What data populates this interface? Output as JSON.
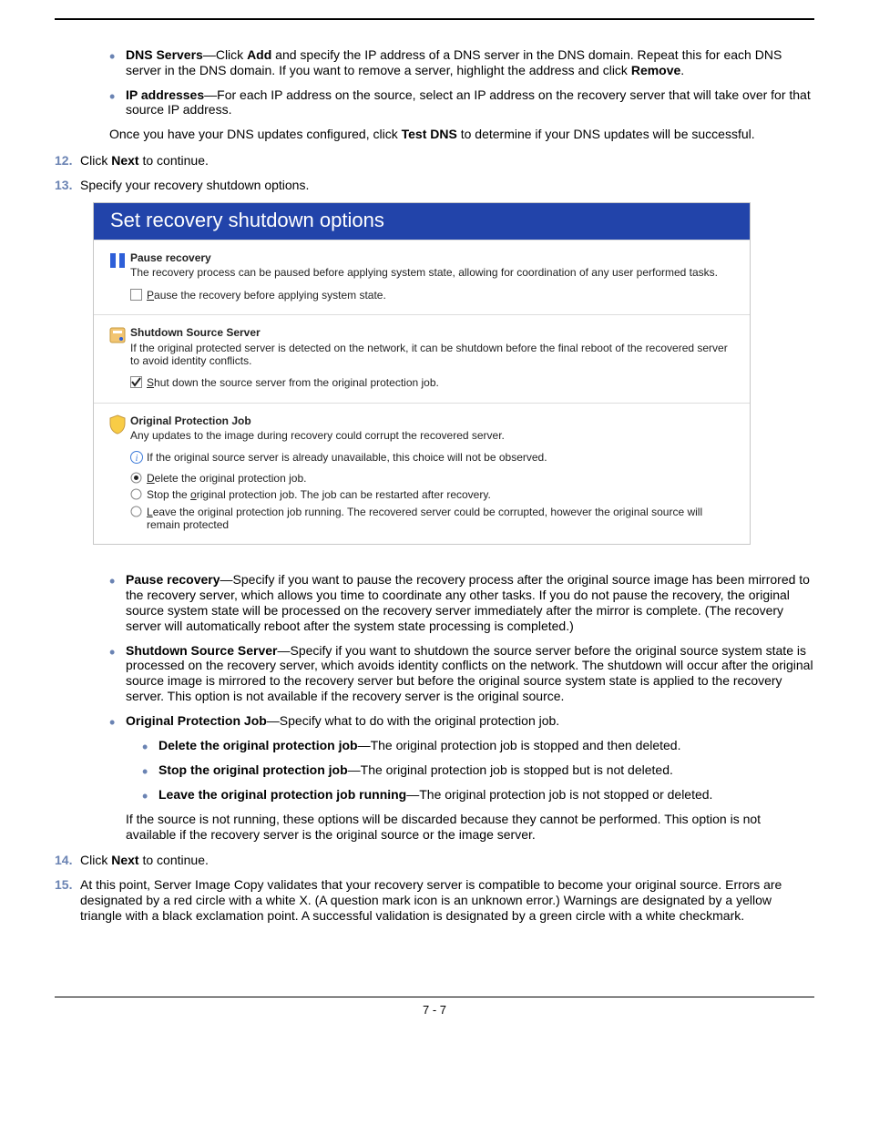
{
  "page_number": "7 - 7",
  "upper_bullets": {
    "dns": {
      "label": "DNS Servers",
      "pre": "—Click ",
      "add": "Add",
      "mid": " and specify the IP address of a DNS server in the DNS domain. Repeat this for each DNS server in the DNS domain. If you want to remove a server, highlight the address and click ",
      "remove": "Remove",
      "end": "."
    },
    "ip": {
      "label": "IP addresses",
      "text": "—For each IP address on the source, select an IP address on the recovery server that will take over for that source IP address."
    }
  },
  "dns_test_para": {
    "pre": "Once you have your DNS updates configured, click ",
    "bold": "Test DNS",
    "post": " to determine if your DNS updates will be successful."
  },
  "steps": {
    "s12": {
      "num": "12.",
      "pre": "Click ",
      "bold": "Next",
      "post": " to continue."
    },
    "s13": {
      "num": "13.",
      "text": "Specify your recovery shutdown options."
    },
    "s14": {
      "num": "14.",
      "pre": "Click ",
      "bold": "Next",
      "post": " to continue."
    },
    "s15": {
      "num": "15.",
      "text": "At this point, Server Image Copy validates that your recovery server is compatible to become your original source. Errors are designated by a red circle with a white X. (A question mark icon is an unknown error.) Warnings are designated by a yellow triangle with a black exclamation point. A successful validation is designated by a green circle with a white checkmark."
    }
  },
  "dialog": {
    "title": "Set recovery shutdown options",
    "pause": {
      "heading": "Pause recovery",
      "sub": "The recovery process can be paused before applying system state, allowing for coordination of any user performed tasks.",
      "checkbox_letter": "P",
      "checkbox_rest": "ause the recovery before applying system state."
    },
    "shutdown": {
      "heading": "Shutdown Source Server",
      "sub": "If the original protected server is detected on the network, it can be shutdown before the final reboot of the recovered server to avoid identity conflicts.",
      "checkbox_letter": "S",
      "checkbox_rest": "hut down the source server from the original protection job."
    },
    "original": {
      "heading": "Original Protection Job",
      "sub": "Any updates to the image during recovery could corrupt the recovered server.",
      "note": "If the original source server is already unavailable, this choice will not be observed.",
      "r1_letter": "D",
      "r1_rest": "elete the original protection job.",
      "r2_pre": "Stop the ",
      "r2_letter": "o",
      "r2_rest": "riginal protection job. The job can be restarted after recovery.",
      "r3_letter": "L",
      "r3_rest": "eave the original protection job running. The recovered server could be corrupted, however the original source will remain protected"
    }
  },
  "explain": {
    "pause": {
      "label": "Pause recovery",
      "text": "—Specify if you want to pause the recovery process after the original source image has been mirrored to the recovery server, which allows you time to coordinate any other tasks. If you do not pause the recovery, the original source system state will be processed on the recovery server immediately after the mirror is complete. (The recovery server will automatically reboot after the system state processing is completed.)"
    },
    "shutdown": {
      "label": "Shutdown Source Server",
      "text": "—Specify if you want to shutdown the source server before the original source system state is processed on the recovery server, which avoids identity conflicts on the network. The shutdown will occur after the original source image is mirrored to the recovery server but before the original source system state is applied to the recovery server. This option is not available if the recovery server is the original source."
    },
    "original": {
      "label": "Original Protection Job",
      "text": "—Specify what to do with the original protection job."
    },
    "sub": {
      "delete": {
        "label": "Delete the original protection job",
        "text": "—The original protection job is stopped and then deleted."
      },
      "stop": {
        "label": "Stop the original protection job",
        "text": "—The original protection job is stopped but is not deleted."
      },
      "leave": {
        "label": "Leave the original protection job running",
        "text": "—The original protection job is not stopped or deleted."
      }
    },
    "original_note": "If the source is not running, these options will be discarded because they cannot be performed. This option is not available if the recovery server is the original source or the image server."
  }
}
